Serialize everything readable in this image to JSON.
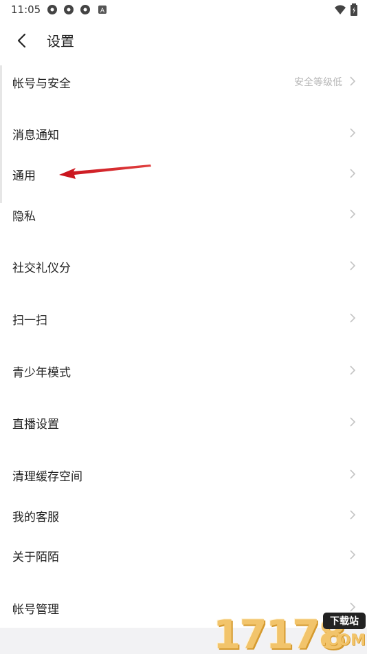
{
  "status": {
    "time": "11:05",
    "icons": [
      "pinwheel-icon",
      "pinwheel-icon",
      "pinwheel-icon",
      "a-icon"
    ],
    "right_icons": [
      "wifi-icon",
      "battery-icon"
    ]
  },
  "header": {
    "title": "设置",
    "back_icon": "chevron-left-icon"
  },
  "menu": {
    "items": [
      {
        "label": "帐号与安全",
        "value": "安全等级低"
      },
      {
        "label": "消息通知"
      },
      {
        "label": "通用"
      },
      {
        "label": "隐私"
      },
      {
        "label": "社交礼仪分"
      },
      {
        "label": "扫一扫"
      },
      {
        "label": "青少年模式"
      },
      {
        "label": "直播设置"
      },
      {
        "label": "清理缓存空间"
      },
      {
        "label": "我的客服"
      },
      {
        "label": "关于陌陌"
      },
      {
        "label": "帐号管理"
      }
    ]
  },
  "watermark": {
    "digits": "17178",
    "badge": "下载站",
    "suffix": ".COM"
  },
  "colors": {
    "text": "#222222",
    "muted": "#b5b5b5",
    "arrow": "#d0151b",
    "strip": "#f2f2f4"
  }
}
